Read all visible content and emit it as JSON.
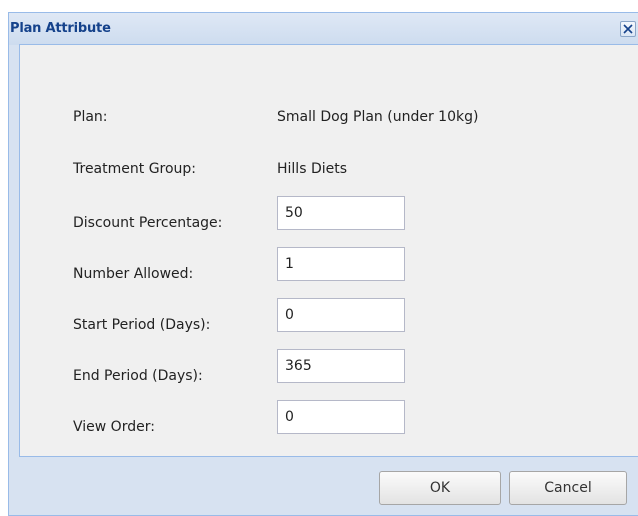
{
  "dialog": {
    "title": "Plan Attribute",
    "close_icon": "close-icon"
  },
  "form": {
    "plan_label": "Plan:",
    "plan_value": "Small Dog Plan (under 10kg)",
    "treatment_group_label": "Treatment Group:",
    "treatment_group_value": "Hills Diets",
    "discount_percentage_label": "Discount Percentage:",
    "discount_percentage_value": "50",
    "number_allowed_label": "Number Allowed:",
    "number_allowed_value": "1",
    "start_period_label": "Start Period (Days):",
    "start_period_value": "0",
    "end_period_label": "End Period (Days):",
    "end_period_value": "365",
    "view_order_label": "View Order:",
    "view_order_value": "0"
  },
  "buttons": {
    "ok_label": "OK",
    "cancel_label": "Cancel"
  },
  "colors": {
    "title_text": "#15428b",
    "frame": "#d7e2f1",
    "border": "#99bbe8",
    "panel": "#f0f0f0"
  }
}
